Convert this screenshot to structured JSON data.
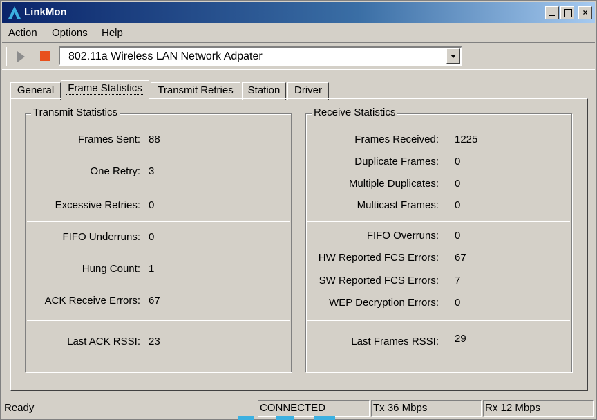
{
  "window": {
    "title": "LinkMon",
    "controls": {
      "minimize": "_",
      "maximize": "□",
      "close": "×"
    }
  },
  "menu": [
    {
      "label": "Action",
      "accel": "A",
      "rest": "ction"
    },
    {
      "label": "Options",
      "accel": "O",
      "rest": "ptions"
    },
    {
      "label": "Help",
      "accel": "H",
      "rest": "elp"
    }
  ],
  "toolbar": {
    "play_icon": "play-icon",
    "stop_icon": "stop-icon",
    "adapter": "802.11a Wireless LAN Network Adpater"
  },
  "tabs": [
    {
      "label": "General"
    },
    {
      "label": "Frame Statistics",
      "active": true
    },
    {
      "label": "Transmit Retries"
    },
    {
      "label": "Station"
    },
    {
      "label": "Driver"
    }
  ],
  "transmit": {
    "title": "Transmit Statistics",
    "rows": [
      {
        "label": "Frames Sent:",
        "value": "88"
      },
      {
        "label": "One Retry:",
        "value": "3"
      },
      {
        "label": "Excessive Retries:",
        "value": "0"
      },
      {
        "label": "FIFO Underruns:",
        "value": "0"
      },
      {
        "label": "Hung Count:",
        "value": "1"
      },
      {
        "label": "ACK Receive Errors:",
        "value": "67"
      },
      {
        "label": "Last ACK RSSI:",
        "value": "23"
      }
    ]
  },
  "receive": {
    "title": "Receive Statistics",
    "rows": [
      {
        "label": "Frames Received:",
        "value": "1225"
      },
      {
        "label": "Duplicate Frames:",
        "value": "0"
      },
      {
        "label": "Multiple Duplicates:",
        "value": "0"
      },
      {
        "label": "Multicast Frames:",
        "value": "0"
      },
      {
        "label": "FIFO Overruns:",
        "value": "0"
      },
      {
        "label": "HW Reported FCS Errors:",
        "value": "67"
      },
      {
        "label": "SW Reported FCS Errors:",
        "value": "7"
      },
      {
        "label": "WEP Decryption Errors:",
        "value": "0"
      },
      {
        "label": "Last Frames RSSI:",
        "value": "29"
      }
    ]
  },
  "status": {
    "ready": "Ready",
    "connection": "CONNECTED",
    "tx": "Tx 36 Mbps",
    "rx": "Rx 12 Mbps"
  },
  "colors": {
    "titlebar_start": "#0a246a",
    "titlebar_end": "#a6caf0",
    "stop": "#e8501c",
    "face": "#d4d0c8"
  }
}
